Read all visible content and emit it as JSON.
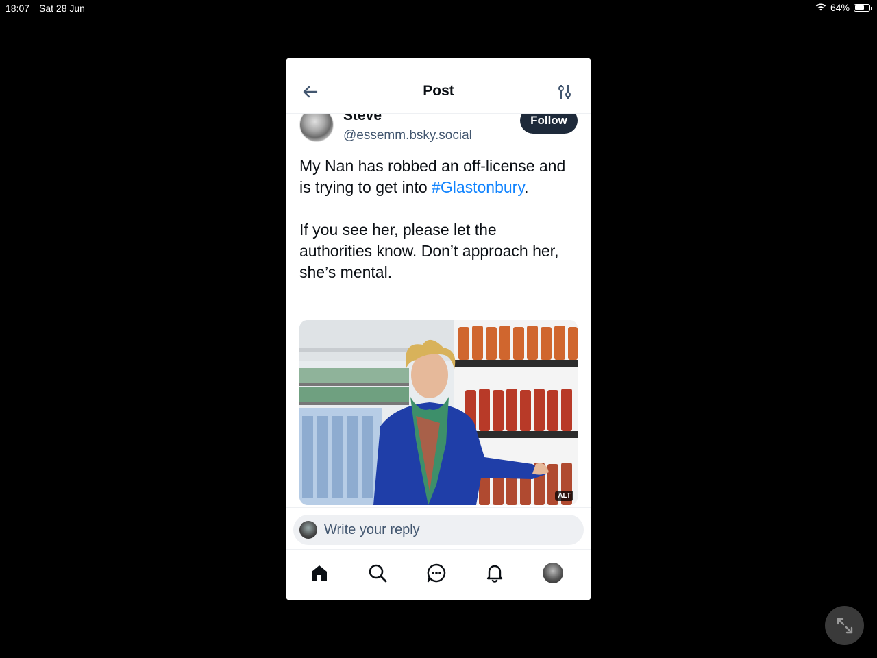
{
  "status_bar": {
    "time": "18:07",
    "date": "Sat 28 Jun",
    "battery": "64%",
    "battery_level": 0.64
  },
  "header": {
    "title": "Post"
  },
  "post": {
    "author_name": "Steve",
    "author_handle": "@essemm.bsky.social",
    "follow_label": "Follow",
    "text_line1_a": "My Nan has robbed an off-license and is trying to get into ",
    "hashtag": "#Glastonbury",
    "text_line1_b": ".",
    "text_para2": "If you see her, please let the authorities know. Don’t approach her, she’s mental.",
    "image_alt_badge": "ALT"
  },
  "reply": {
    "placeholder": "Write your reply"
  },
  "tabs": [
    "home-icon",
    "search-icon",
    "chat-icon",
    "bell-icon",
    "profile-avatar"
  ]
}
